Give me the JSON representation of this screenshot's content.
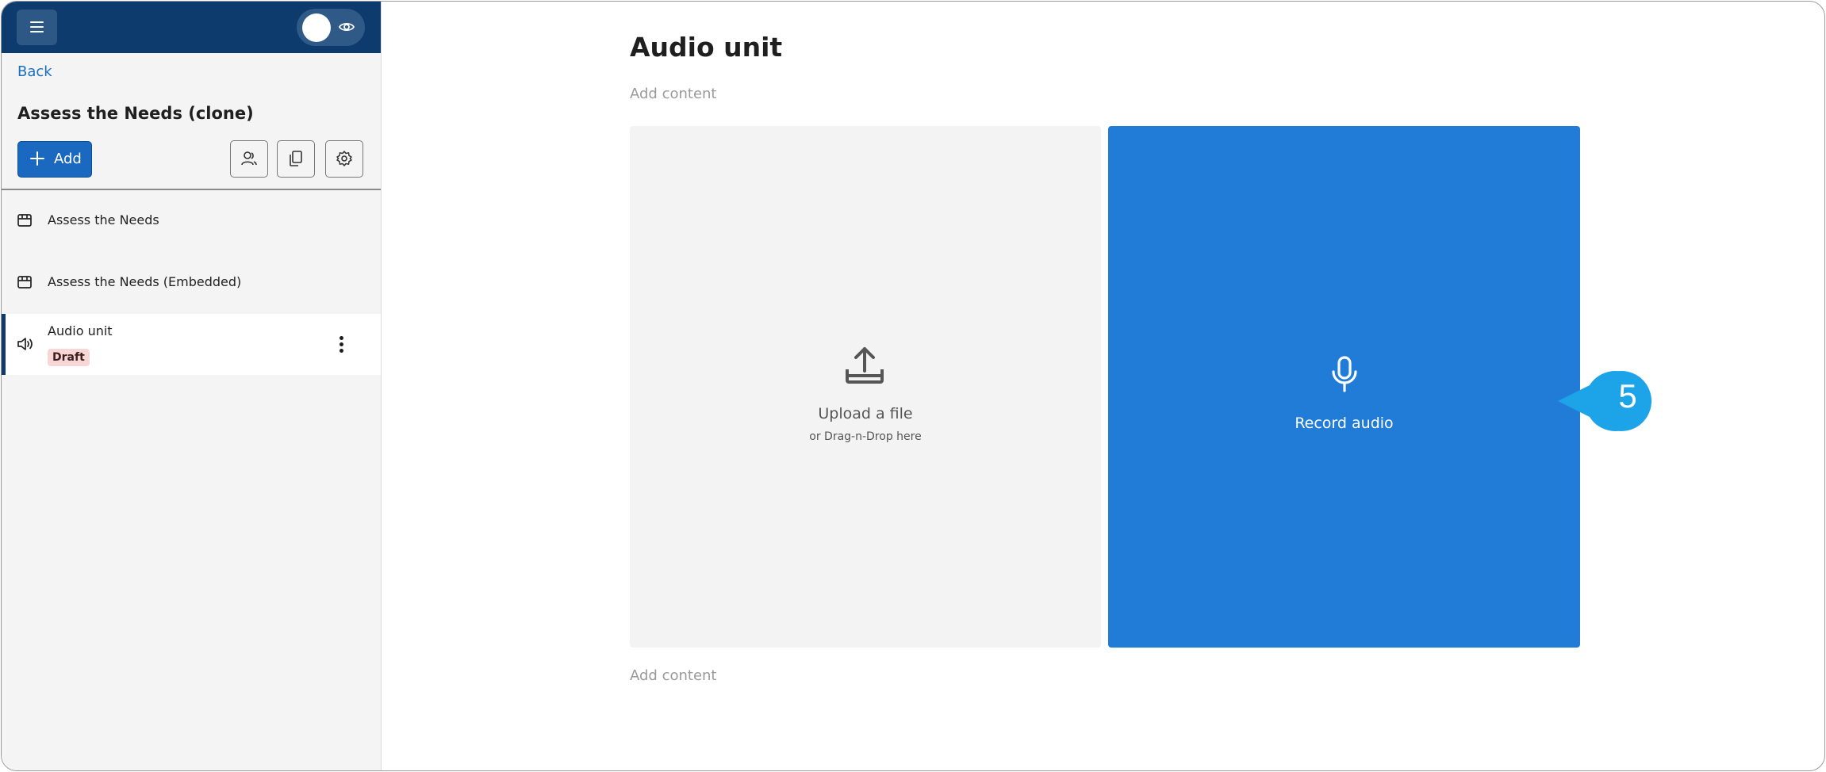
{
  "sidebar": {
    "back_label": "Back",
    "course_title": "Assess the Needs (clone)",
    "add_label": "Add",
    "items": [
      {
        "label": "Assess the Needs",
        "icon": "calendar-box-icon"
      },
      {
        "label": "Assess the Needs (Embedded)",
        "icon": "calendar-box-icon"
      },
      {
        "label": "Audio unit",
        "icon": "speaker-icon",
        "badge": "Draft",
        "active": true
      }
    ]
  },
  "main": {
    "title": "Audio unit",
    "add_content_top": "Add content",
    "add_content_bottom": "Add content",
    "upload": {
      "label": "Upload a file",
      "sublabel": "or Drag-n-Drop here"
    },
    "record": {
      "label": "Record audio"
    }
  },
  "callout": {
    "number": "5"
  },
  "colors": {
    "topbar": "#0d3b6e",
    "primary": "#1a68bf",
    "record_panel": "#217cd7",
    "callout": "#1ca3e8",
    "draft_badge": "#f9d6d6"
  }
}
